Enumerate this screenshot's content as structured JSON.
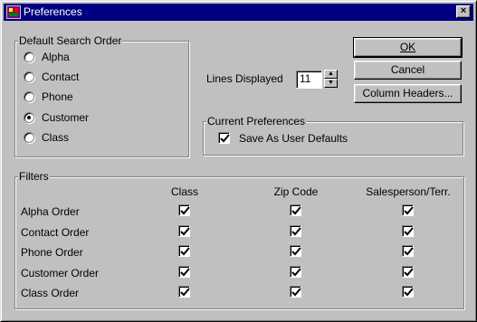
{
  "window": {
    "title": "Preferences",
    "close_glyph": "×"
  },
  "search_order": {
    "label": "Default Search Order",
    "options": [
      {
        "label": "Alpha",
        "selected": false
      },
      {
        "label": "Contact",
        "selected": false
      },
      {
        "label": "Phone",
        "selected": false
      },
      {
        "label": "Customer",
        "selected": true
      },
      {
        "label": "Class",
        "selected": false
      }
    ]
  },
  "lines_displayed": {
    "label": "Lines Displayed",
    "value": "11"
  },
  "buttons": {
    "ok": "OK",
    "cancel": "Cancel",
    "column_headers": "Column Headers..."
  },
  "current_preferences": {
    "label": "Current Preferences",
    "save_defaults_label": "Save As User Defaults",
    "save_defaults_checked": true
  },
  "filters": {
    "label": "Filters",
    "columns": [
      "Class",
      "Zip Code",
      "Salesperson/Terr."
    ],
    "rows": [
      {
        "label": "Alpha Order",
        "checks": [
          true,
          true,
          true
        ]
      },
      {
        "label": "Contact Order",
        "checks": [
          true,
          true,
          true
        ]
      },
      {
        "label": "Phone Order",
        "checks": [
          true,
          true,
          true
        ]
      },
      {
        "label": "Customer Order",
        "checks": [
          true,
          true,
          true
        ]
      },
      {
        "label": "Class Order",
        "checks": [
          true,
          true,
          true
        ]
      }
    ]
  }
}
